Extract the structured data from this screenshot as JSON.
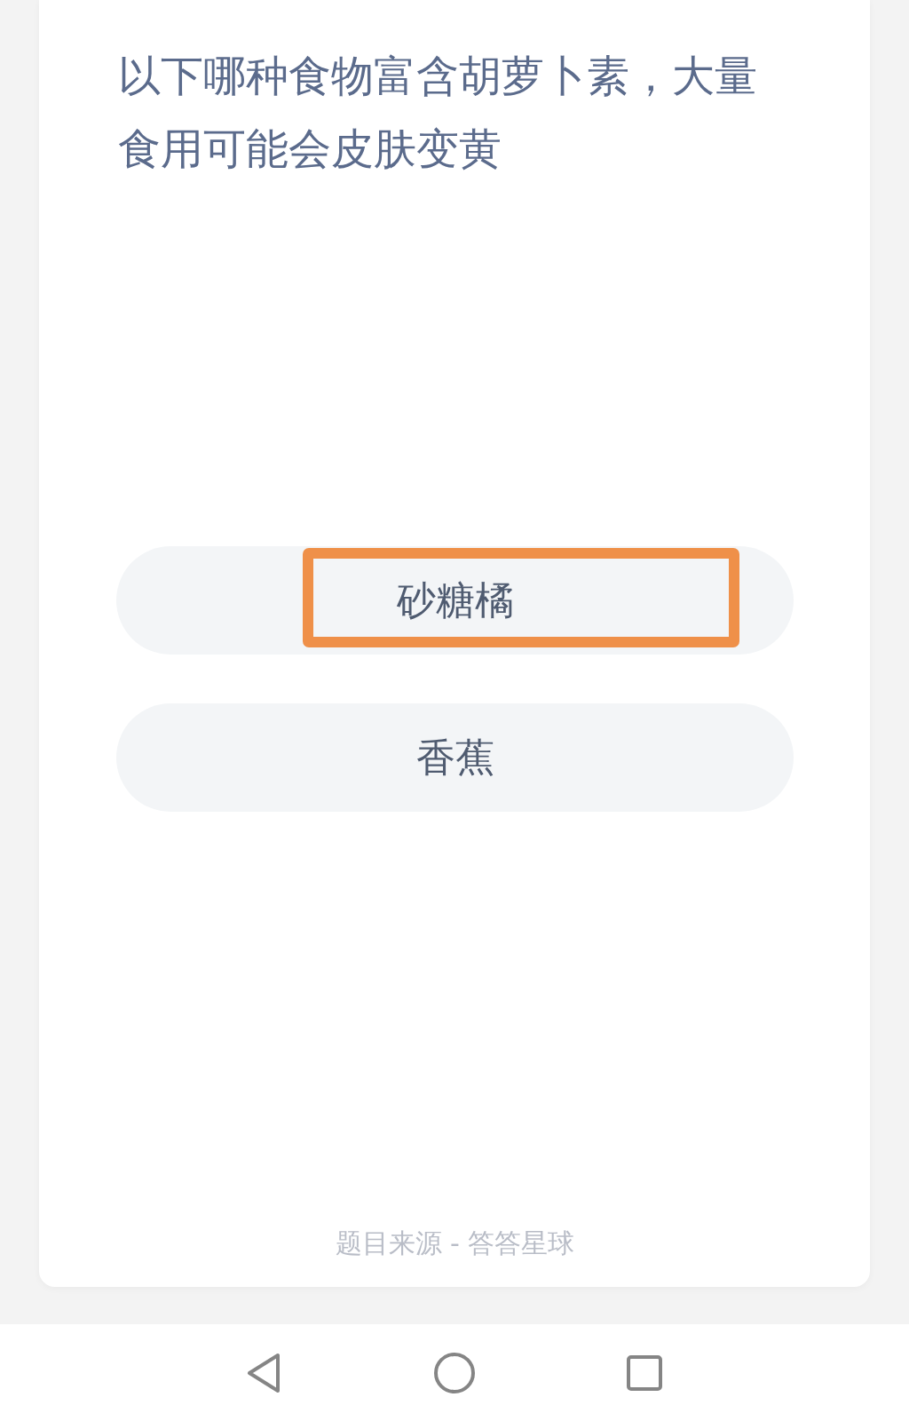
{
  "question": {
    "text": "以下哪种食物富含胡萝卜素，大量食用可能会皮肤变黄"
  },
  "options": [
    {
      "label": "砂糖橘",
      "highlighted": true
    },
    {
      "label": "香蕉",
      "highlighted": false
    }
  ],
  "source": "题目来源 - 答答星球",
  "nav_bar": {
    "buttons": [
      {
        "kind": "back"
      },
      {
        "kind": "home"
      },
      {
        "kind": "recents"
      }
    ]
  }
}
